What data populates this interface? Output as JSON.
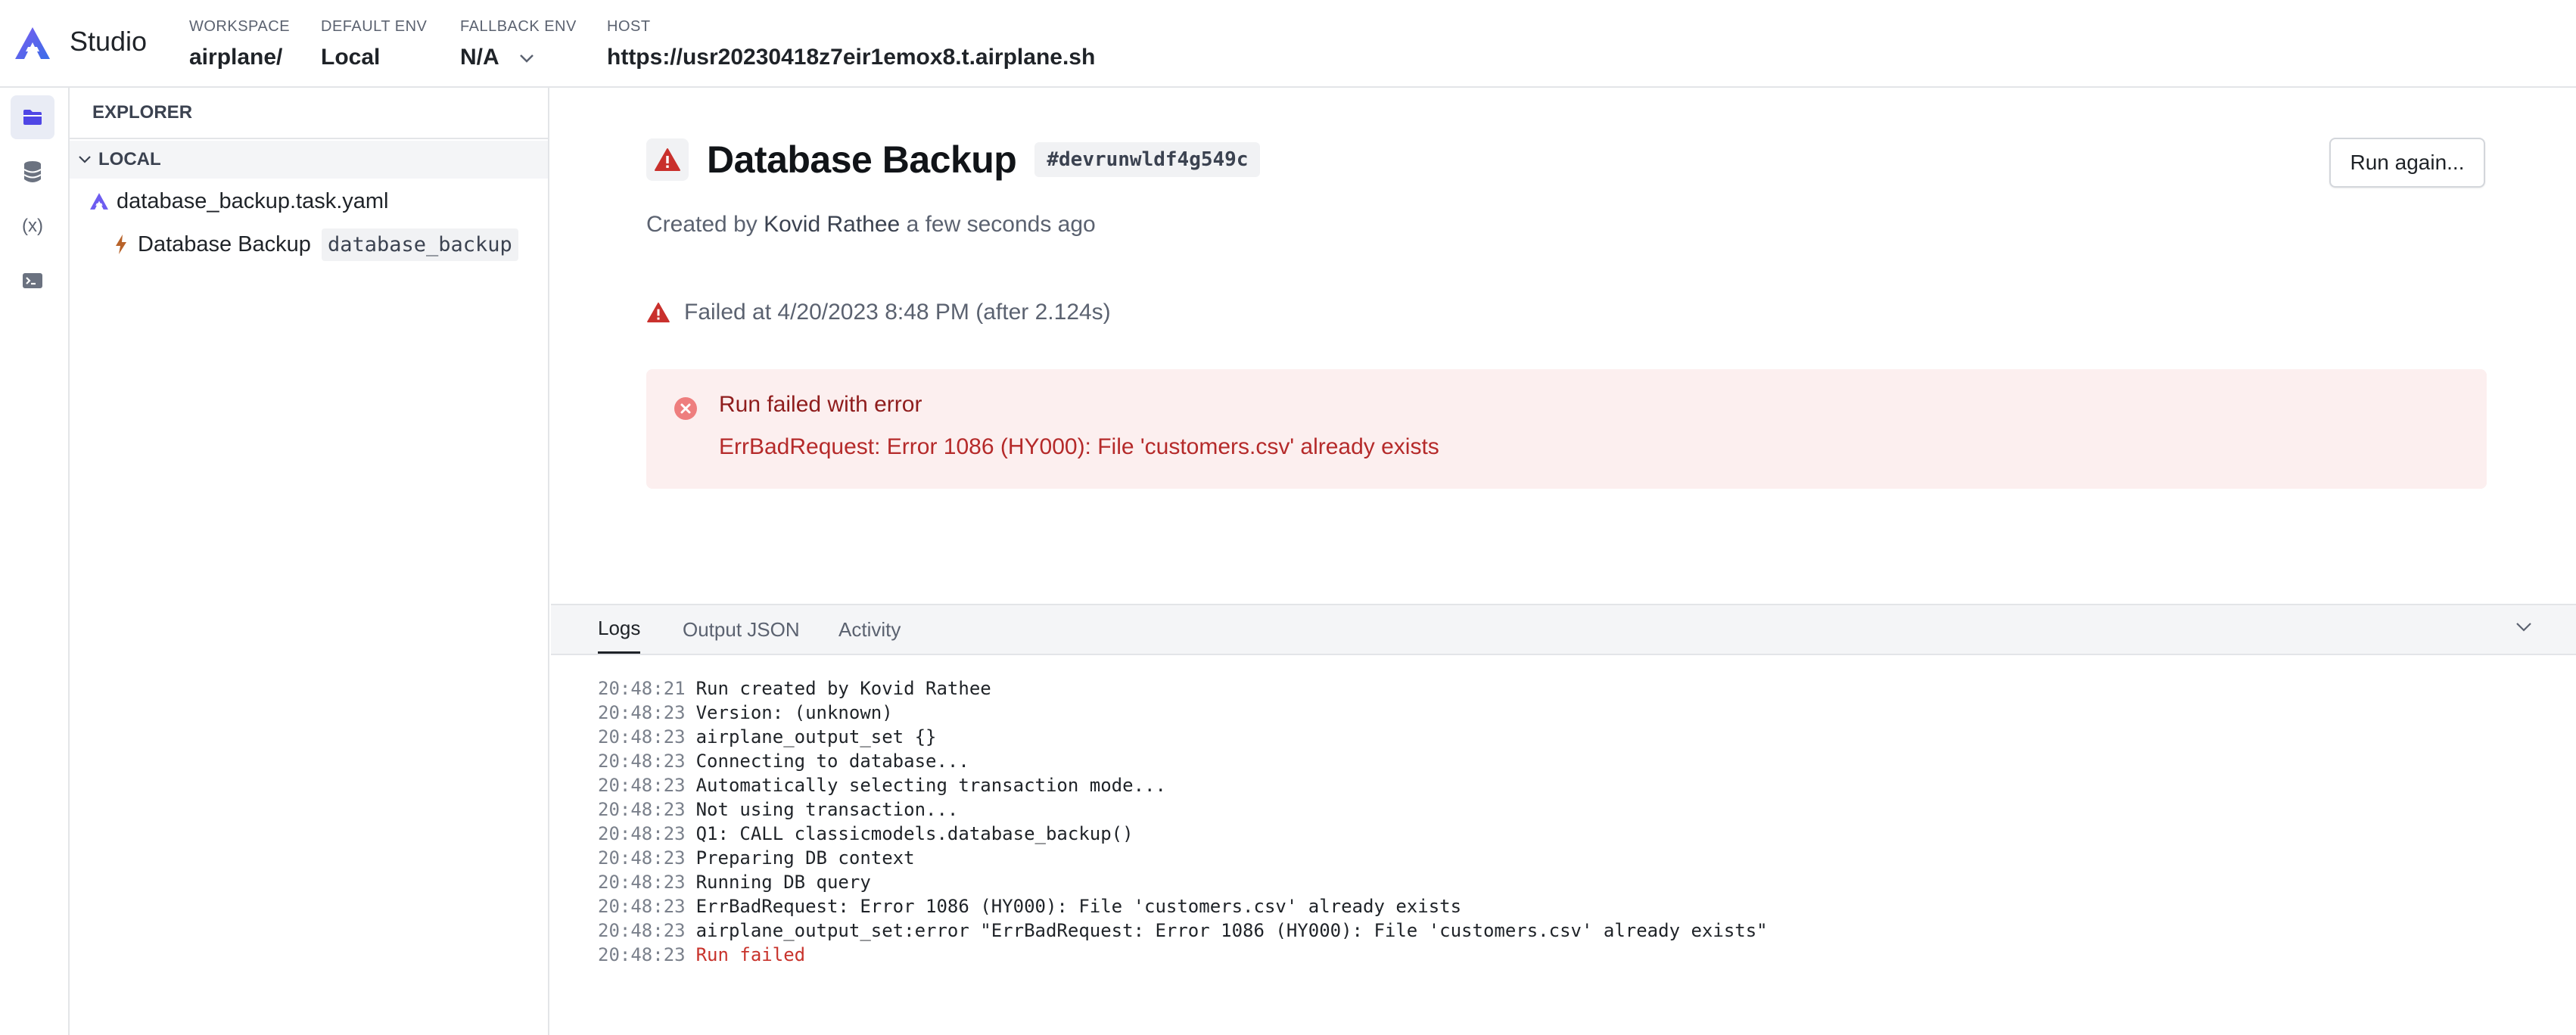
{
  "topbar": {
    "brand": "Studio",
    "workspace_label": "WORKSPACE",
    "workspace_value": "airplane/",
    "default_env_label": "DEFAULT ENV",
    "default_env_value": "Local",
    "fallback_env_label": "FALLBACK ENV",
    "fallback_env_value": "N/A",
    "host_label": "HOST",
    "host_value": "https://usr20230418z7eir1emox8.t.airplane.sh"
  },
  "rail": {
    "items": [
      {
        "name": "folder-icon",
        "active": true
      },
      {
        "name": "database-icon",
        "active": false
      },
      {
        "name": "variables-icon",
        "label": "(x)",
        "active": false
      },
      {
        "name": "terminal-icon",
        "active": false
      }
    ]
  },
  "explorer": {
    "heading": "EXPLORER",
    "section": "LOCAL",
    "file": "database_backup.task.yaml",
    "task_name": "Database Backup",
    "task_slug": "database_backup"
  },
  "run": {
    "title": "Database Backup",
    "id": "#devrunwldf4g549c",
    "run_again": "Run again...",
    "created_prefix": "Created by",
    "created_by": "Kovid Rathee",
    "created_suffix": "a few seconds ago",
    "failed_at": "Failed at 4/20/2023 8:48 PM (after 2.124s)",
    "error_title": "Run failed with error",
    "error_message": "ErrBadRequest: Error 1086 (HY000): File 'customers.csv' already exists"
  },
  "tabs": {
    "items": [
      "Logs",
      "Output JSON",
      "Activity"
    ],
    "active": "Logs"
  },
  "logs": [
    {
      "time": "20:48:21",
      "msg": "Run created by Kovid Rathee"
    },
    {
      "time": "20:48:23",
      "msg": "Version: (unknown)"
    },
    {
      "time": "20:48:23",
      "msg": "airplane_output_set {}"
    },
    {
      "time": "20:48:23",
      "msg": "Connecting to database..."
    },
    {
      "time": "20:48:23",
      "msg": "Automatically selecting transaction mode..."
    },
    {
      "time": "20:48:23",
      "msg": "Not using transaction..."
    },
    {
      "time": "20:48:23",
      "msg": "Q1: CALL classicmodels.database_backup()"
    },
    {
      "time": "20:48:23",
      "msg": "Preparing DB context"
    },
    {
      "time": "20:48:23",
      "msg": "Running DB query"
    },
    {
      "time": "20:48:23",
      "msg": "ErrBadRequest: Error 1086 (HY000): File 'customers.csv' already exists"
    },
    {
      "time": "20:48:23",
      "msg": "airplane_output_set:error \"ErrBadRequest: Error 1086 (HY000): File 'customers.csv' already exists\""
    },
    {
      "time": "20:48:23",
      "msg": "Run failed"
    }
  ],
  "colors": {
    "accent": "#5b50e6",
    "error_bg": "#fcefef",
    "error_text": "#b52a2a",
    "warning": "#c9302c"
  }
}
